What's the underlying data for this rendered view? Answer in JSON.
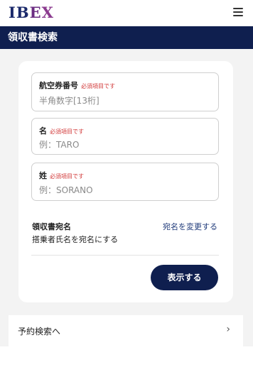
{
  "header": {
    "logo_text": "IBEX",
    "menu_icon": "hamburger-menu-icon"
  },
  "page": {
    "title": "領収書検索"
  },
  "form": {
    "ticket_number": {
      "label": "航空券番号",
      "required": "必須項目です",
      "placeholder": "半角数字[13桁]"
    },
    "first_name": {
      "label": "名",
      "required": "必須項目です",
      "placeholder": "例：TARO"
    },
    "last_name": {
      "label": "姓",
      "required": "必須項目です",
      "placeholder": "例：SORANO"
    },
    "receipt_addressee": {
      "label": "領収書宛名",
      "change_link": "宛名を変更する",
      "value": "搭乗者氏名を宛名にする"
    },
    "submit_label": "表示する"
  },
  "nav": {
    "reservation_search_label": "予約検索へ",
    "chevron": "›"
  },
  "colors": {
    "navy": "#0f1f4f",
    "required_red": "#d23a3a",
    "link_blue": "#1f3a7a"
  }
}
